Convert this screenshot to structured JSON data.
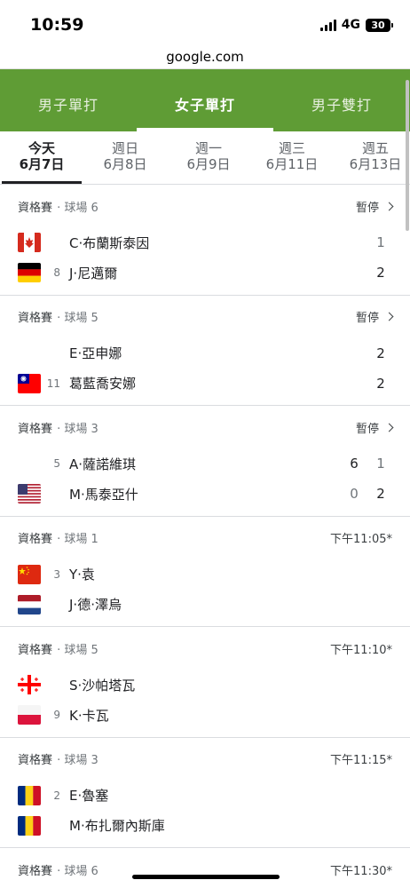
{
  "status_bar": {
    "time": "10:59",
    "network": "4G",
    "battery": "30"
  },
  "url": "google.com",
  "tabs": [
    {
      "label": "男子單打",
      "active": false
    },
    {
      "label": "女子單打",
      "active": true
    },
    {
      "label": "男子雙打",
      "active": false
    }
  ],
  "dates": [
    {
      "dow": "今天",
      "day": "6月7日",
      "active": true
    },
    {
      "dow": "週日",
      "day": "6月8日",
      "active": false
    },
    {
      "dow": "週一",
      "day": "6月9日",
      "active": false
    },
    {
      "dow": "週三",
      "day": "6月11日",
      "active": false
    },
    {
      "dow": "週五",
      "day": "6月13日",
      "active": false
    }
  ],
  "matches": [
    {
      "round": "資格賽",
      "court": "· 球場 6",
      "status": "暫停",
      "chevron": true,
      "players": [
        {
          "flag": "canada",
          "seed": "",
          "name": "C·布蘭斯泰因",
          "scores": [
            {
              "v": "1",
              "win": false
            }
          ]
        },
        {
          "flag": "germany",
          "seed": "8",
          "name": "J·尼邁爾",
          "scores": [
            {
              "v": "2",
              "win": true
            }
          ]
        }
      ]
    },
    {
      "round": "資格賽",
      "court": "· 球場 5",
      "status": "暫停",
      "chevron": true,
      "players": [
        {
          "flag": "none",
          "seed": "",
          "name": "E·亞申娜",
          "scores": [
            {
              "v": "2",
              "win": true
            }
          ]
        },
        {
          "flag": "taiwan",
          "seed": "11",
          "name": "葛藍喬安娜",
          "scores": [
            {
              "v": "2",
              "win": true
            }
          ]
        }
      ]
    },
    {
      "round": "資格賽",
      "court": "· 球場 3",
      "status": "暫停",
      "chevron": true,
      "players": [
        {
          "flag": "none",
          "seed": "5",
          "name": "A·薩諾維琪",
          "scores": [
            {
              "v": "6",
              "win": true
            },
            {
              "v": "1",
              "win": false
            }
          ]
        },
        {
          "flag": "usa",
          "seed": "",
          "name": "M·馬泰亞什",
          "scores": [
            {
              "v": "0",
              "win": false
            },
            {
              "v": "2",
              "win": true
            }
          ]
        }
      ]
    },
    {
      "round": "資格賽",
      "court": "· 球場 1",
      "status": "下午11:05*",
      "chevron": false,
      "players": [
        {
          "flag": "china",
          "seed": "3",
          "name": "Y·袁",
          "scores": []
        },
        {
          "flag": "netherlands",
          "seed": "",
          "name": "J·德·澤烏",
          "scores": []
        }
      ]
    },
    {
      "round": "資格賽",
      "court": "· 球場 5",
      "status": "下午11:10*",
      "chevron": false,
      "players": [
        {
          "flag": "georgia",
          "seed": "",
          "name": "S·沙帕塔瓦",
          "scores": []
        },
        {
          "flag": "poland",
          "seed": "9",
          "name": "K·卡瓦",
          "scores": []
        }
      ]
    },
    {
      "round": "資格賽",
      "court": "· 球場 3",
      "status": "下午11:15*",
      "chevron": false,
      "players": [
        {
          "flag": "romania",
          "seed": "2",
          "name": "E·魯塞",
          "scores": []
        },
        {
          "flag": "romania",
          "seed": "",
          "name": "M·布扎爾內斯庫",
          "scores": []
        }
      ]
    }
  ],
  "last_match": {
    "round": "資格賽",
    "court": "· 球場 6",
    "status": "下午11:30*"
  },
  "colors": {
    "accent_green": "#5f9c35"
  }
}
